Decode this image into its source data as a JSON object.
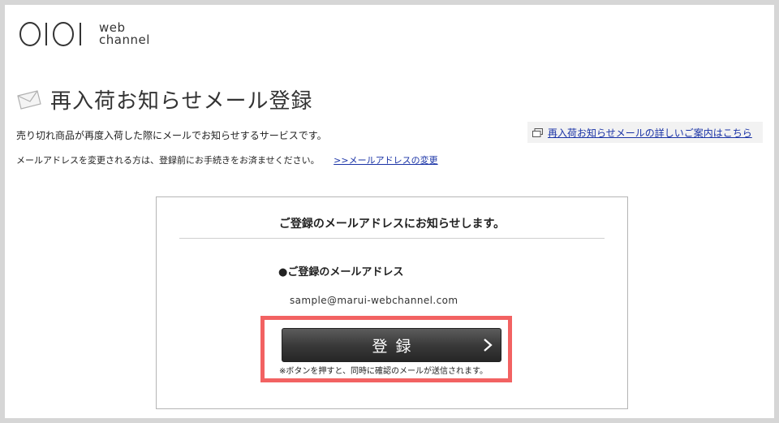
{
  "header": {
    "logo_text_1": "web",
    "logo_text_2": "channel"
  },
  "page": {
    "title": "再入荷お知らせメール登録",
    "description": "売り切れ商品が再度入荷した際にメールでお知らせするサービスです。",
    "guide_link": "再入荷お知らせメールの詳しいご案内はこちら",
    "note": "メールアドレスを変更される方は、登録前にお手続きをお済ませください。",
    "change_link": ">>メールアドレスの変更"
  },
  "panel": {
    "heading": "ご登録のメールアドレスにお知らせします。",
    "email_label": "●ご登録のメールアドレス",
    "email_value": "sample@marui-webchannel.com",
    "register_button": "登録",
    "button_note": "※ボタンを押すと、同時に確認のメールが送信されます。"
  },
  "colors": {
    "highlight_border": "#f26262",
    "link": "#1a33a6",
    "button_dark": "#2a2a2a"
  },
  "icons": {
    "title_icon": "envelope-icon",
    "guide_icon": "window-icon",
    "button_icon": "chevron-right-icon"
  }
}
